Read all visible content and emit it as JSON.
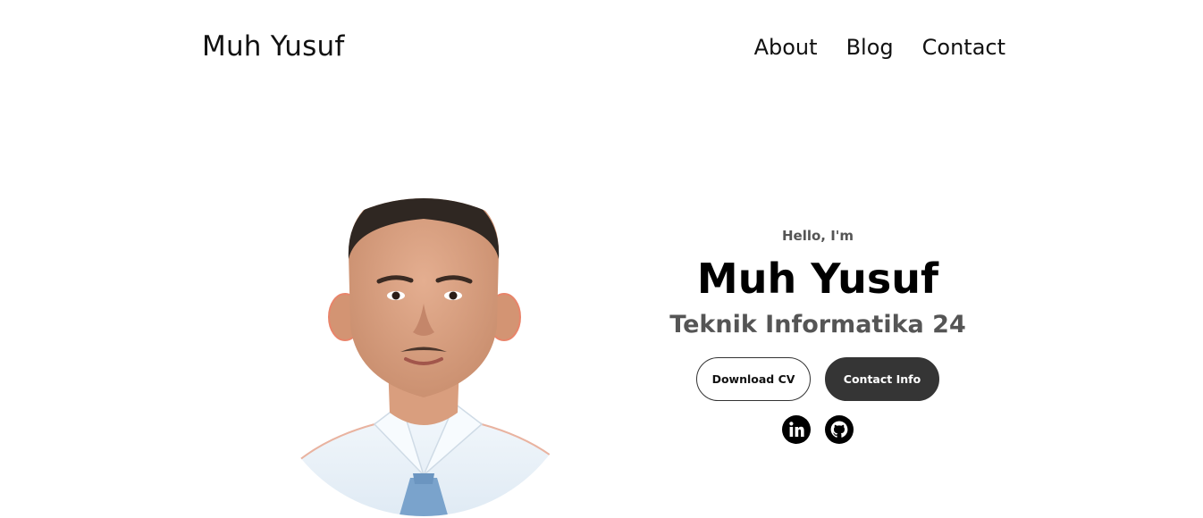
{
  "nav": {
    "logo": "Muh Yusuf",
    "links": [
      "About",
      "Blog",
      "Contact"
    ]
  },
  "hero": {
    "greeting": "Hello, I'm",
    "name": "Muh Yusuf",
    "subtitle": "Teknik Informatika 24",
    "buttons": {
      "download": "Download CV",
      "contact": "Contact Info"
    },
    "socials": [
      {
        "icon": "linkedin-icon"
      },
      {
        "icon": "github-icon"
      }
    ]
  },
  "colors": {
    "text": "#111111",
    "muted": "#555555",
    "button_dark": "#353535",
    "background": "#ffffff"
  }
}
